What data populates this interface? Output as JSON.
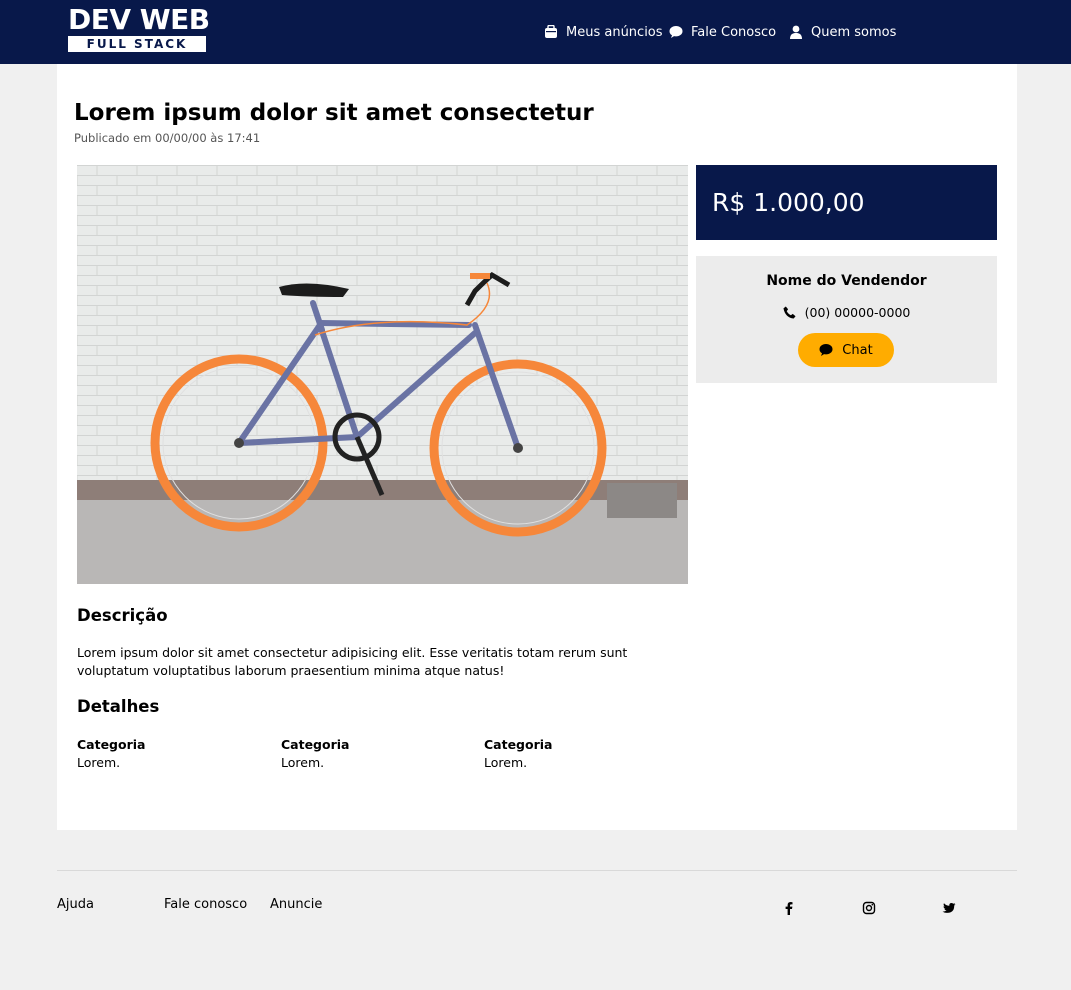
{
  "header": {
    "logo_top": "DEV WEB",
    "logo_bottom": "FULL STACK",
    "nav": {
      "my_ads": "Meus anúncios",
      "contact": "Fale Conosco",
      "about": "Quem somos"
    }
  },
  "listing": {
    "title": "Lorem ipsum dolor sit amet consectetur",
    "published": "Publicado em 00/00/00 às 17:41",
    "price": "R$ 1.000,00",
    "image_alt": "Bicicleta azul com rodas laranja"
  },
  "seller": {
    "name": "Nome do Vendendor",
    "phone": "(00) 00000-0000",
    "chat_label": "Chat"
  },
  "description": {
    "heading": "Descrição",
    "text": "Lorem ipsum dolor sit amet consectetur adipisicing elit. Esse veritatis totam rerum sunt voluptatum voluptatibus laborum praesentium minima atque natus!"
  },
  "details": {
    "heading": "Detalhes",
    "items": [
      {
        "label": "Categoria",
        "value": "Lorem."
      },
      {
        "label": "Categoria",
        "value": "Lorem."
      },
      {
        "label": "Categoria",
        "value": "Lorem."
      }
    ]
  },
  "footer": {
    "links": [
      "Ajuda",
      "Fale conosco",
      "Anuncie"
    ],
    "social": [
      "facebook-icon",
      "instagram-icon",
      "twitter-icon"
    ]
  },
  "colors": {
    "primary": "#08184a",
    "accent": "#ffac00",
    "background": "#f0f0f0"
  }
}
